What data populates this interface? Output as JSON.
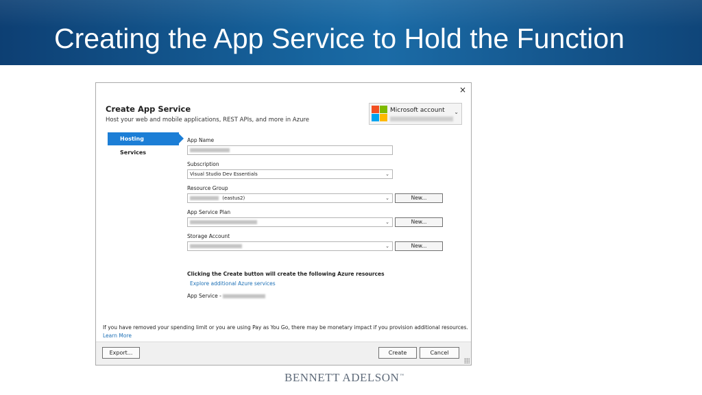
{
  "slide": {
    "title": "Creating the App Service to Hold the Function",
    "brand": "BENNETT ADELSON",
    "brand_mark": "™"
  },
  "dialog": {
    "close_glyph": "×",
    "title": "Create App Service",
    "subtitle": "Host your web and mobile applications, REST APIs, and more in Azure",
    "account": {
      "label": "Microsoft account",
      "chevron": "⌄"
    },
    "nav": {
      "hosting": "Hosting",
      "services": "Services"
    },
    "fields": {
      "app_name_label": "App Name",
      "subscription_label": "Subscription",
      "subscription_value": "Visual Studio Dev Essentials",
      "resource_group_label": "Resource Group",
      "resource_group_suffix": "(eastus2)",
      "app_service_plan_label": "App Service Plan",
      "storage_account_label": "Storage Account",
      "select_chevron": "⌄"
    },
    "new_button_label": "New...",
    "create_note": "Clicking the Create button will create the following Azure resources",
    "explore_link": "Explore additional Azure services",
    "app_service_prefix": "App Service - ",
    "footer_note": "If you have removed your spending limit or you are using Pay as You Go, there may be monetary impact if you provision additional resources.",
    "learn_more": "Learn More",
    "buttons": {
      "export": "Export...",
      "create": "Create",
      "cancel": "Cancel"
    }
  },
  "colors": {
    "header_blue": "#17659f",
    "selected_nav": "#1c7ed6",
    "link": "#1c6fb5"
  }
}
